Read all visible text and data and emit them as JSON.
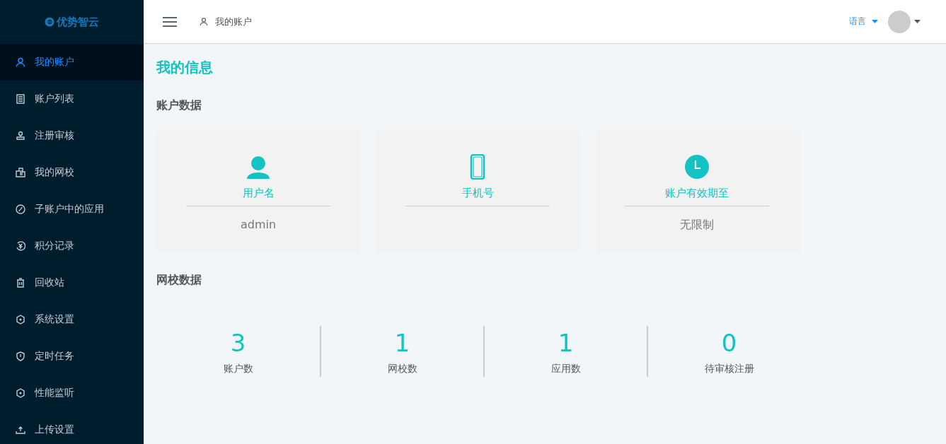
{
  "sidebar": {
    "logo": "优势智云",
    "items": [
      {
        "label": "我的账户",
        "selected": true
      },
      {
        "label": "账户列表",
        "selected": false
      },
      {
        "label": "注册审核",
        "selected": false
      },
      {
        "label": "我的网校",
        "selected": false
      },
      {
        "label": "子账户中的应用",
        "selected": false
      },
      {
        "label": "积分记录",
        "selected": false
      },
      {
        "label": "回收站",
        "selected": false
      },
      {
        "label": "系统设置",
        "selected": false
      },
      {
        "label": "定时任务",
        "selected": false
      },
      {
        "label": "性能监听",
        "selected": false
      },
      {
        "label": "上传设置",
        "selected": false
      }
    ]
  },
  "header": {
    "breadcrumb": "我的账户",
    "language": "语言"
  },
  "page_title": "我的信息",
  "account_section": {
    "title": "账户数据",
    "cards": [
      {
        "kind": "user",
        "label": "用户名",
        "value": "admin"
      },
      {
        "kind": "phone",
        "label": "手机号"
      },
      {
        "kind": "clock",
        "label": "账户有效期至",
        "value": "无限制"
      }
    ]
  },
  "school_section": {
    "title": "网校数据",
    "stats": [
      {
        "value": "3",
        "label": "账户数"
      },
      {
        "value": "1",
        "label": "网校数"
      },
      {
        "value": "1",
        "label": "应用数"
      },
      {
        "value": "0",
        "label": "待审核注册"
      }
    ]
  }
}
